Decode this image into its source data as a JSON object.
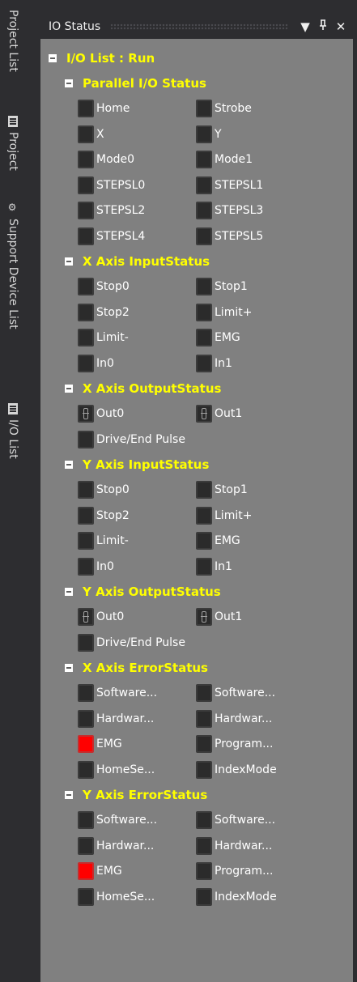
{
  "sidebar": {
    "tabs": [
      {
        "label": "Project List",
        "icon": "none"
      },
      {
        "label": "Project",
        "icon": "document-icon"
      },
      {
        "label": "Support Device List",
        "icon": "devices-icon"
      },
      {
        "label": "I/O List",
        "icon": "list-icon"
      }
    ]
  },
  "window": {
    "title": "IO Status",
    "buttons": {
      "dropdown": "▼",
      "pin": "ᵖ",
      "close": "✕"
    }
  },
  "tree": {
    "root": "I/O List : Run",
    "sections": [
      {
        "title": "Parallel I/O Status",
        "items": [
          {
            "label": "Home"
          },
          {
            "label": "Strobe"
          },
          {
            "label": "X"
          },
          {
            "label": "Y"
          },
          {
            "label": "Mode0"
          },
          {
            "label": "Mode1"
          },
          {
            "label": "STEPSL0"
          },
          {
            "label": "STEPSL1"
          },
          {
            "label": "STEPSL2"
          },
          {
            "label": "STEPSL3"
          },
          {
            "label": "STEPSL4"
          },
          {
            "label": "STEPSL5"
          }
        ]
      },
      {
        "title": "X Axis InputStatus",
        "items": [
          {
            "label": "Stop0"
          },
          {
            "label": "Stop1"
          },
          {
            "label": "Stop2"
          },
          {
            "label": "Limit+"
          },
          {
            "label": "Limit-"
          },
          {
            "label": "EMG"
          },
          {
            "label": "In0"
          },
          {
            "label": "In1"
          }
        ]
      },
      {
        "title": "X Axis OutputStatus",
        "items": [
          {
            "label": "Out0",
            "type": "output"
          },
          {
            "label": "Out1",
            "type": "output"
          },
          {
            "label": "Drive/End Pulse"
          }
        ]
      },
      {
        "title": "Y Axis InputStatus",
        "items": [
          {
            "label": "Stop0"
          },
          {
            "label": "Stop1"
          },
          {
            "label": "Stop2"
          },
          {
            "label": "Limit+"
          },
          {
            "label": "Limit-"
          },
          {
            "label": "EMG"
          },
          {
            "label": "In0"
          },
          {
            "label": "In1"
          }
        ]
      },
      {
        "title": "Y Axis OutputStatus",
        "items": [
          {
            "label": "Out0",
            "type": "output"
          },
          {
            "label": "Out1",
            "type": "output"
          },
          {
            "label": "Drive/End Pulse"
          }
        ]
      },
      {
        "title": "X Axis ErrorStatus",
        "items": [
          {
            "label": "Software..."
          },
          {
            "label": "Software..."
          },
          {
            "label": "Hardwar..."
          },
          {
            "label": "Hardwar..."
          },
          {
            "label": "EMG",
            "active": true
          },
          {
            "label": "Program..."
          },
          {
            "label": "HomeSe..."
          },
          {
            "label": "IndexMode"
          }
        ]
      },
      {
        "title": "Y Axis ErrorStatus",
        "items": [
          {
            "label": "Software..."
          },
          {
            "label": "Software..."
          },
          {
            "label": "Hardwar..."
          },
          {
            "label": "Hardwar..."
          },
          {
            "label": "EMG",
            "active": true
          },
          {
            "label": "Program..."
          },
          {
            "label": "HomeSe..."
          },
          {
            "label": "IndexMode"
          }
        ]
      }
    ]
  },
  "colors": {
    "background": "#2d2d30",
    "panel": "#808080",
    "heading": "#ffff00",
    "led_off": "#2b2b2b",
    "led_on": "#ff0000"
  }
}
